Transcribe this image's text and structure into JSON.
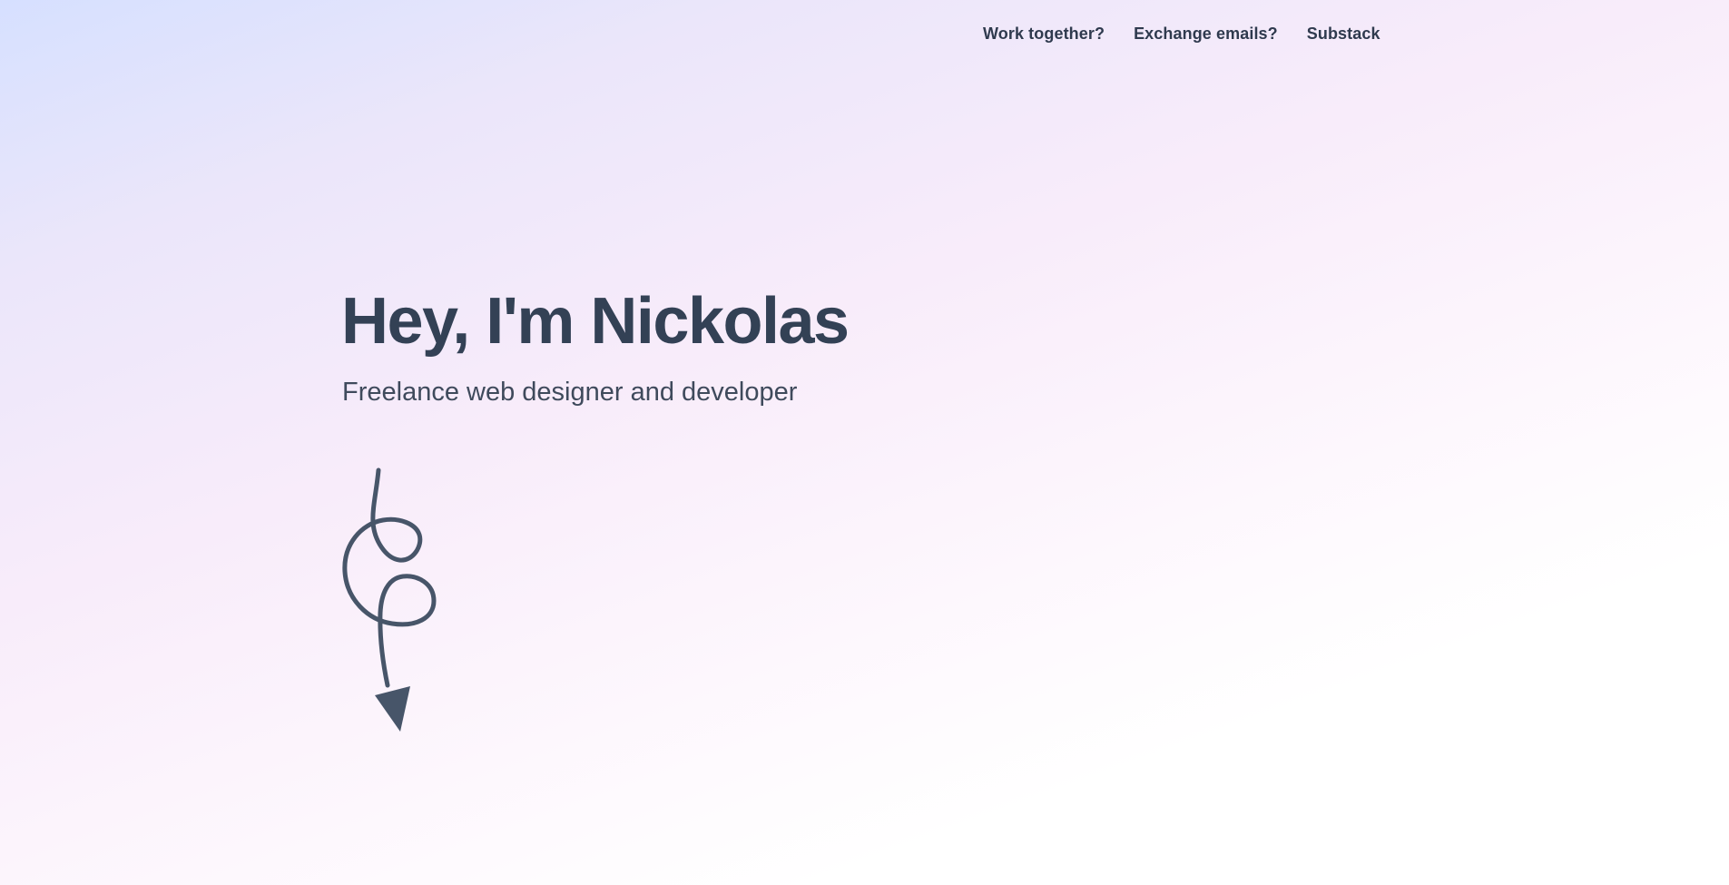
{
  "nav": {
    "items": [
      {
        "label": "Work together?"
      },
      {
        "label": "Exchange emails?"
      },
      {
        "label": "Substack"
      }
    ]
  },
  "hero": {
    "title": "Hey, I'm Nickolas",
    "subtitle": "Freelance web designer and developer"
  },
  "decor": {
    "arrow_icon": "hand-drawn-loopy-arrow-down-icon"
  },
  "colors": {
    "text": "#334155",
    "gradient_top_left": "#d6e0ff",
    "gradient_mid": "#f8ecfa",
    "gradient_bottom_right": "#ffffff"
  }
}
